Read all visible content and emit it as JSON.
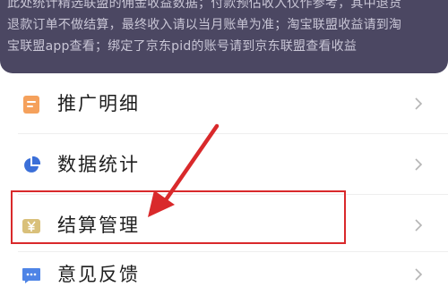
{
  "notice": {
    "line1": "此处统计精选联盟的佣金收益数据；付款预估收入仅作参考，其中退货",
    "line2": "退款订单不做结算，最终收入请以当月账单为准；淘宝联盟收益请到淘",
    "line3": "宝联盟app查看；绑定了京东pid的账号请到京东联盟查看收益"
  },
  "menu": {
    "items": [
      {
        "label": "推广明细",
        "icon": "document-icon",
        "icon_color": "#f5a15c"
      },
      {
        "label": "数据统计",
        "icon": "pie-chart-icon",
        "icon_color": "#3b6fd8"
      },
      {
        "label": "结算管理",
        "icon": "yen-icon",
        "icon_color": "#d9c07a"
      },
      {
        "label": "意见反馈",
        "icon": "message-icon",
        "icon_color": "#4e84e6"
      }
    ]
  },
  "annotation": {
    "color": "#d9292b"
  }
}
